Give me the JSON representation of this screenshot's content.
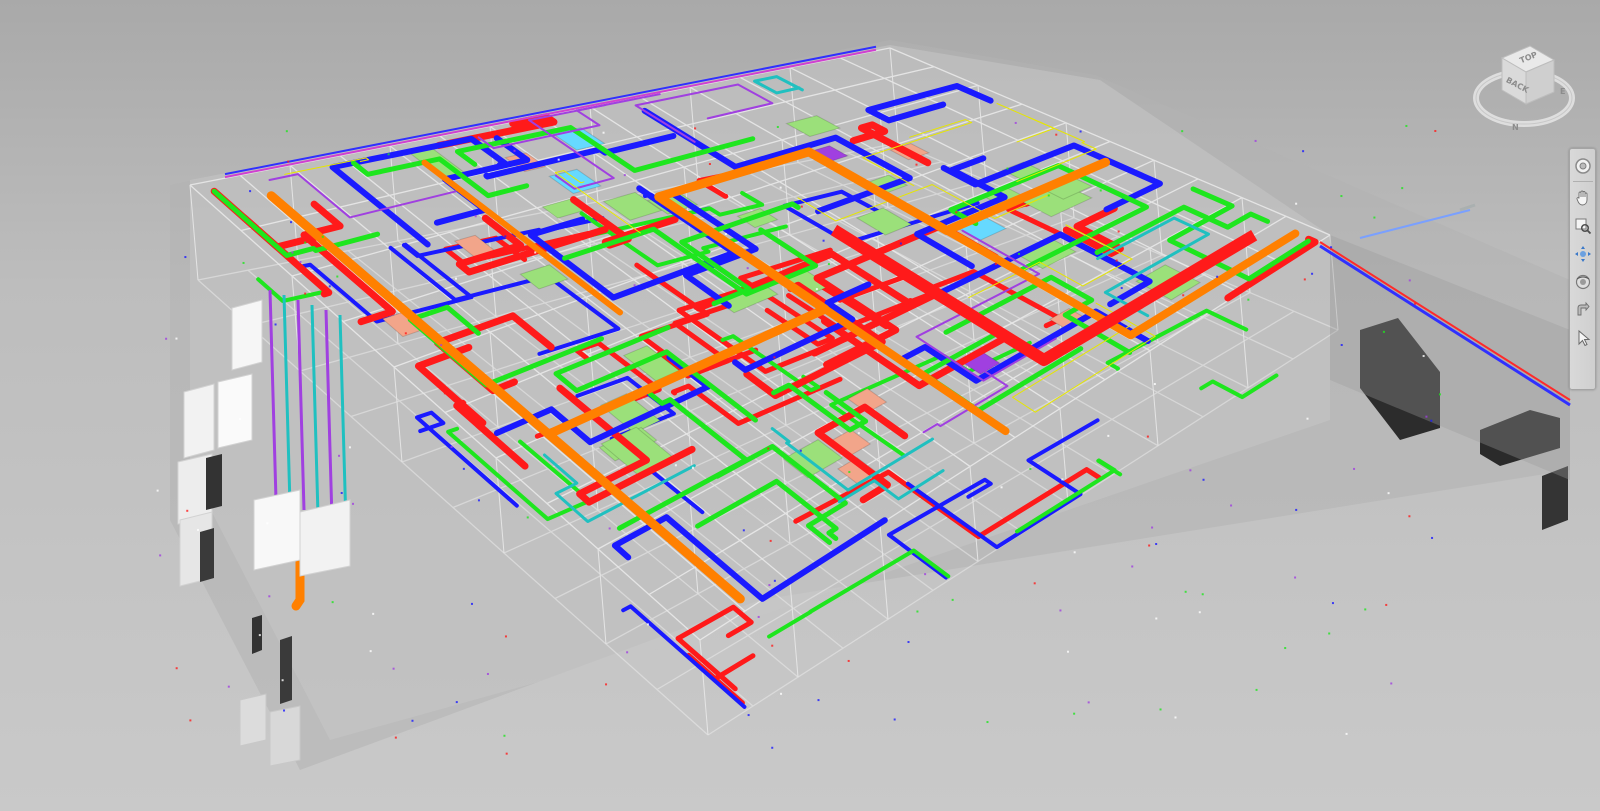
{
  "viewcube": {
    "faces": {
      "top": "TOP",
      "back": "BACK"
    },
    "compass": {
      "east": "E",
      "north": "N"
    }
  },
  "navbar": {
    "tools": [
      {
        "name": "steering-wheel",
        "icon": "steering-wheel-icon"
      },
      {
        "name": "pan",
        "icon": "pan-hand-icon"
      },
      {
        "name": "zoom",
        "icon": "zoom-magnifier-icon"
      },
      {
        "name": "navigate",
        "icon": "navigate-arrows-icon"
      },
      {
        "name": "orbit",
        "icon": "orbit-icon"
      },
      {
        "name": "look",
        "icon": "look-icon"
      },
      {
        "name": "select",
        "icon": "select-pointer-icon"
      }
    ]
  },
  "colors": {
    "background": "#bdbdbd",
    "structure_grid": "#e6e6e6",
    "supply_duct": "#ff1a1a",
    "return_duct": "#1a1aff",
    "exhaust_duct": "#1ee61e",
    "main_duct": "#ff8000",
    "equipment": "#9be07a",
    "equipment_alt": "#f2a58a",
    "chilled_water": "#66d9ff",
    "condenser_water": "#20c0c0",
    "plumbing": "#a040e0",
    "electrical": "#e6e600",
    "dark_equipment": "#2e2e2e",
    "white_equipment": "#f4f4f4"
  }
}
